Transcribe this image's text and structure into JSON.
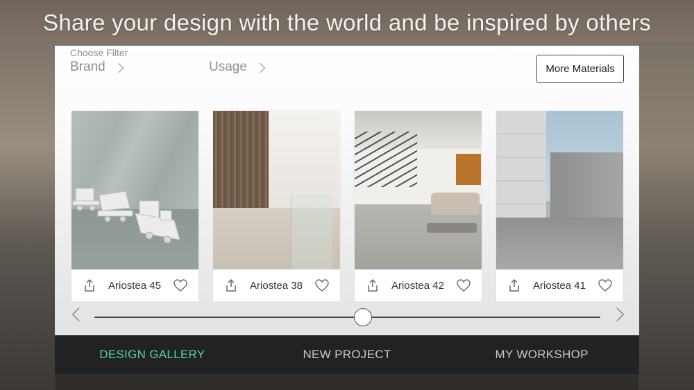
{
  "headline": "Share your design with the world and be inspired by others",
  "filters": {
    "caption": "Choose Filter",
    "brand_label": "Brand",
    "usage_label": "Usage"
  },
  "more_materials_label": "More Materials",
  "cards": [
    {
      "title": "Ariostea 45",
      "image": "marble-toy-trains"
    },
    {
      "title": "Ariostea 38",
      "image": "walnut-panel-interior"
    },
    {
      "title": "Ariostea 42",
      "image": "loft-living-room"
    },
    {
      "title": "Ariostea 41",
      "image": "concrete-facade"
    }
  ],
  "slider": {
    "position": 0.5
  },
  "tabs": [
    {
      "label": "DESIGN GALLERY",
      "active": true
    },
    {
      "label": "NEW PROJECT",
      "active": false
    },
    {
      "label": "MY WORKSHOP",
      "active": false
    }
  ],
  "colors": {
    "accent": "#4fd1b3",
    "tabbar": "#222222"
  }
}
